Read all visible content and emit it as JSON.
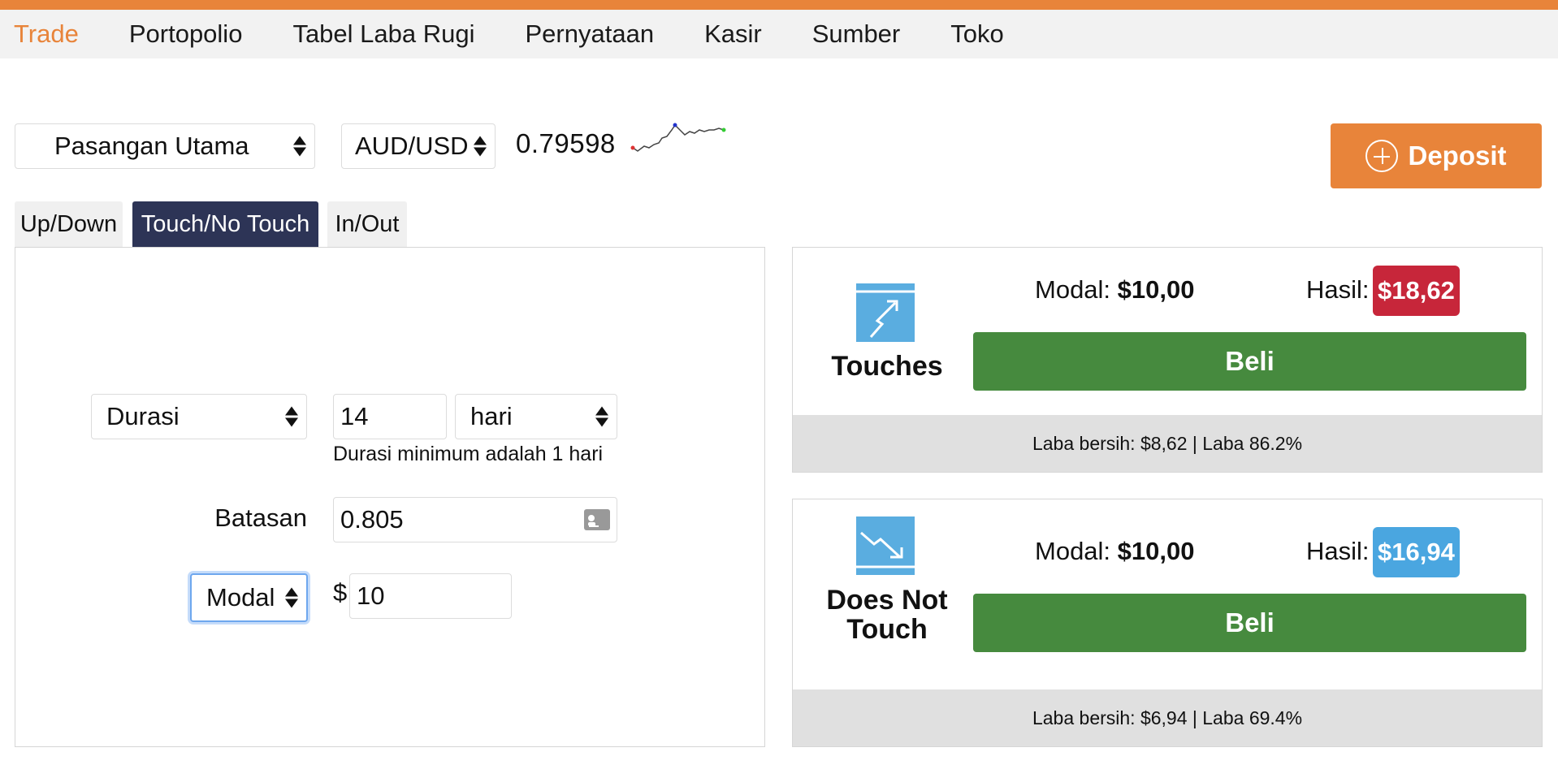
{
  "nav": {
    "items": [
      {
        "label": "Trade",
        "active": true
      },
      {
        "label": "Portopolio"
      },
      {
        "label": "Tabel Laba Rugi"
      },
      {
        "label": "Pernyataan"
      },
      {
        "label": "Kasir"
      },
      {
        "label": "Sumber"
      },
      {
        "label": "Toko"
      }
    ]
  },
  "market": {
    "group_selected": "Pasangan Utama",
    "pair_selected": "AUD/USD",
    "spot_price": "0.79598"
  },
  "deposit": {
    "label": "Deposit",
    "icon": "plus-circle-icon"
  },
  "tabs": [
    {
      "label": "Up/Down"
    },
    {
      "label": "Touch/No Touch",
      "active": true
    },
    {
      "label": "In/Out"
    }
  ],
  "form": {
    "duration_type": "Durasi",
    "duration_value": "14",
    "duration_unit": "hari",
    "duration_hint": "Durasi minimum adalah 1 hari",
    "barrier_label": "Batasan",
    "barrier_value": "0.805",
    "amount_type": "Modal",
    "currency_symbol": "$",
    "amount_value": "10"
  },
  "contracts": {
    "touch": {
      "name": "Touches",
      "stake_label": "Modal:",
      "stake_value": "$10,00",
      "payout_label": "Hasil:",
      "payout_value": "$18,62",
      "buy_label": "Beli",
      "profit_text": "Laba bersih: $8,62 | Laba 86.2%",
      "payout_color": "#c7263a"
    },
    "notouch": {
      "name": "Does Not Touch",
      "stake_label": "Modal:",
      "stake_value": "$10,00",
      "payout_label": "Hasil:",
      "payout_value": "$16,94",
      "buy_label": "Beli",
      "profit_text": "Laba bersih: $6,94 | Laba 69.4%",
      "payout_color": "#4aa6e0"
    }
  },
  "colors": {
    "accent_orange": "#e8843a",
    "tab_active": "#2d3456",
    "buy_green": "#468a3e",
    "icon_blue": "#5aade0"
  }
}
